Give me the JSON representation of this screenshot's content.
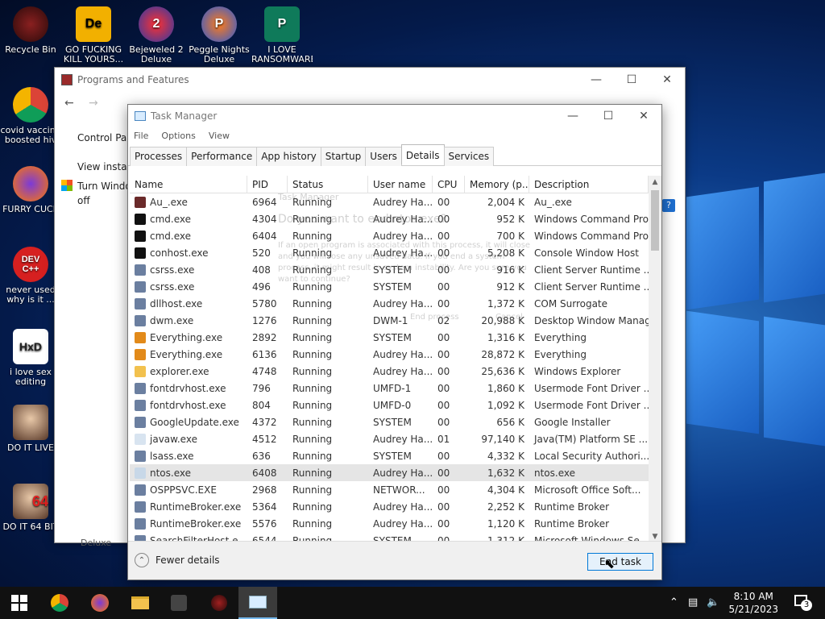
{
  "desktop": {
    "icons": [
      {
        "label": "Recycle Bin"
      },
      {
        "label": "GO FUCKING KILL YOURS..."
      },
      {
        "label": "Bejeweled 2 Deluxe"
      },
      {
        "label": "Peggle Nights Deluxe"
      },
      {
        "label": "I LOVE RANSOMWARE"
      },
      {
        "label": "covid vaccine boosted hiv ..."
      },
      {
        "label": "FURRY CUCK"
      },
      {
        "label": "never used why is it ..."
      },
      {
        "label": "i love sex editing"
      },
      {
        "label": "DO IT LIVE"
      },
      {
        "label": "DO IT 64 BIT"
      }
    ],
    "glyphs": {
      "dev": "DEV C++",
      "hxd": "HxD",
      "de": "De",
      "num": "64"
    }
  },
  "programs_window": {
    "title": "Programs and Features",
    "side1": "Control Par",
    "side2": "View instal",
    "side3": "Turn Windo",
    "side4": "off",
    "behind_label": "Deluxe"
  },
  "task_manager": {
    "title": "Task Manager",
    "menu": [
      "File",
      "Options",
      "View"
    ],
    "tabs": [
      "Processes",
      "Performance",
      "App history",
      "Startup",
      "Users",
      "Details",
      "Services"
    ],
    "columns": [
      "Name",
      "PID",
      "Status",
      "User name",
      "CPU",
      "Memory (p...",
      "Description"
    ],
    "rows": [
      {
        "name": "Au_.exe",
        "pid": "6964",
        "status": "Running",
        "user": "Audrey Ha...",
        "cpu": "00",
        "mem": "2,004 K",
        "desc": "Au_.exe"
      },
      {
        "name": "cmd.exe",
        "pid": "4304",
        "status": "Running",
        "user": "Audrey Ha...",
        "cpu": "00",
        "mem": "952 K",
        "desc": "Windows Command Proc..."
      },
      {
        "name": "cmd.exe",
        "pid": "6404",
        "status": "Running",
        "user": "Audrey Ha...",
        "cpu": "00",
        "mem": "700 K",
        "desc": "Windows Command Proc..."
      },
      {
        "name": "conhost.exe",
        "pid": "520",
        "status": "Running",
        "user": "Audrey Ha...",
        "cpu": "00",
        "mem": "5,208 K",
        "desc": "Console Window Host"
      },
      {
        "name": "csrss.exe",
        "pid": "408",
        "status": "Running",
        "user": "SYSTEM",
        "cpu": "00",
        "mem": "916 K",
        "desc": "Client Server Runtime ..."
      },
      {
        "name": "csrss.exe",
        "pid": "496",
        "status": "Running",
        "user": "SYSTEM",
        "cpu": "00",
        "mem": "912 K",
        "desc": "Client Server Runtime ..."
      },
      {
        "name": "dllhost.exe",
        "pid": "5780",
        "status": "Running",
        "user": "Audrey Ha...",
        "cpu": "00",
        "mem": "1,372 K",
        "desc": "COM Surrogate"
      },
      {
        "name": "dwm.exe",
        "pid": "1276",
        "status": "Running",
        "user": "DWM-1",
        "cpu": "02",
        "mem": "20,988 K",
        "desc": "Desktop Window Manag..."
      },
      {
        "name": "Everything.exe",
        "pid": "2892",
        "status": "Running",
        "user": "SYSTEM",
        "cpu": "00",
        "mem": "1,316 K",
        "desc": "Everything"
      },
      {
        "name": "Everything.exe",
        "pid": "6136",
        "status": "Running",
        "user": "Audrey Ha...",
        "cpu": "00",
        "mem": "28,872 K",
        "desc": "Everything"
      },
      {
        "name": "explorer.exe",
        "pid": "4748",
        "status": "Running",
        "user": "Audrey Ha...",
        "cpu": "00",
        "mem": "25,636 K",
        "desc": "Windows Explorer"
      },
      {
        "name": "fontdrvhost.exe",
        "pid": "796",
        "status": "Running",
        "user": "UMFD-1",
        "cpu": "00",
        "mem": "1,860 K",
        "desc": "Usermode Font Driver ..."
      },
      {
        "name": "fontdrvhost.exe",
        "pid": "804",
        "status": "Running",
        "user": "UMFD-0",
        "cpu": "00",
        "mem": "1,092 K",
        "desc": "Usermode Font Driver ..."
      },
      {
        "name": "GoogleUpdate.exe",
        "pid": "4372",
        "status": "Running",
        "user": "SYSTEM",
        "cpu": "00",
        "mem": "656 K",
        "desc": "Google Installer"
      },
      {
        "name": "javaw.exe",
        "pid": "4512",
        "status": "Running",
        "user": "Audrey Ha...",
        "cpu": "01",
        "mem": "97,140 K",
        "desc": "Java(TM) Platform SE ..."
      },
      {
        "name": "lsass.exe",
        "pid": "636",
        "status": "Running",
        "user": "SYSTEM",
        "cpu": "00",
        "mem": "4,332 K",
        "desc": "Local Security Authori..."
      },
      {
        "name": "ntos.exe",
        "pid": "6408",
        "status": "Running",
        "user": "Audrey Ha...",
        "cpu": "00",
        "mem": "1,632 K",
        "desc": "ntos.exe"
      },
      {
        "name": "OSPPSVC.EXE",
        "pid": "2968",
        "status": "Running",
        "user": "NETWOR...",
        "cpu": "00",
        "mem": "4,304 K",
        "desc": "Microsoft Office Soft..."
      },
      {
        "name": "RuntimeBroker.exe",
        "pid": "5364",
        "status": "Running",
        "user": "Audrey Ha...",
        "cpu": "00",
        "mem": "2,252 K",
        "desc": "Runtime Broker"
      },
      {
        "name": "RuntimeBroker.exe",
        "pid": "5576",
        "status": "Running",
        "user": "Audrey Ha...",
        "cpu": "00",
        "mem": "1,120 K",
        "desc": "Runtime Broker"
      },
      {
        "name": "SearchFilterHost.e...",
        "pid": "6544",
        "status": "Running",
        "user": "SYSTEM",
        "cpu": "00",
        "mem": "1,312 K",
        "desc": "Microsoft Windows Se..."
      }
    ],
    "selected_row": 16,
    "fewer_details": "Fewer details",
    "end_task": "End task",
    "ghost_dialog": {
      "title": "Task Manager",
      "question": "Do you want to end ntos.exe?",
      "body": "If an open program is associated with this process, it will close and you will lose any unsaved data. If you end a system process, it might result in system instability. Are you sure you want to continue?",
      "end_process": "End process",
      "cancel": "Cancel"
    }
  },
  "taskbar": {
    "time": "8:10 AM",
    "date": "5/21/2023",
    "notification_count": "3"
  },
  "colors": {
    "accent": "#0078d7",
    "selected_row": "#e5e5e5"
  }
}
